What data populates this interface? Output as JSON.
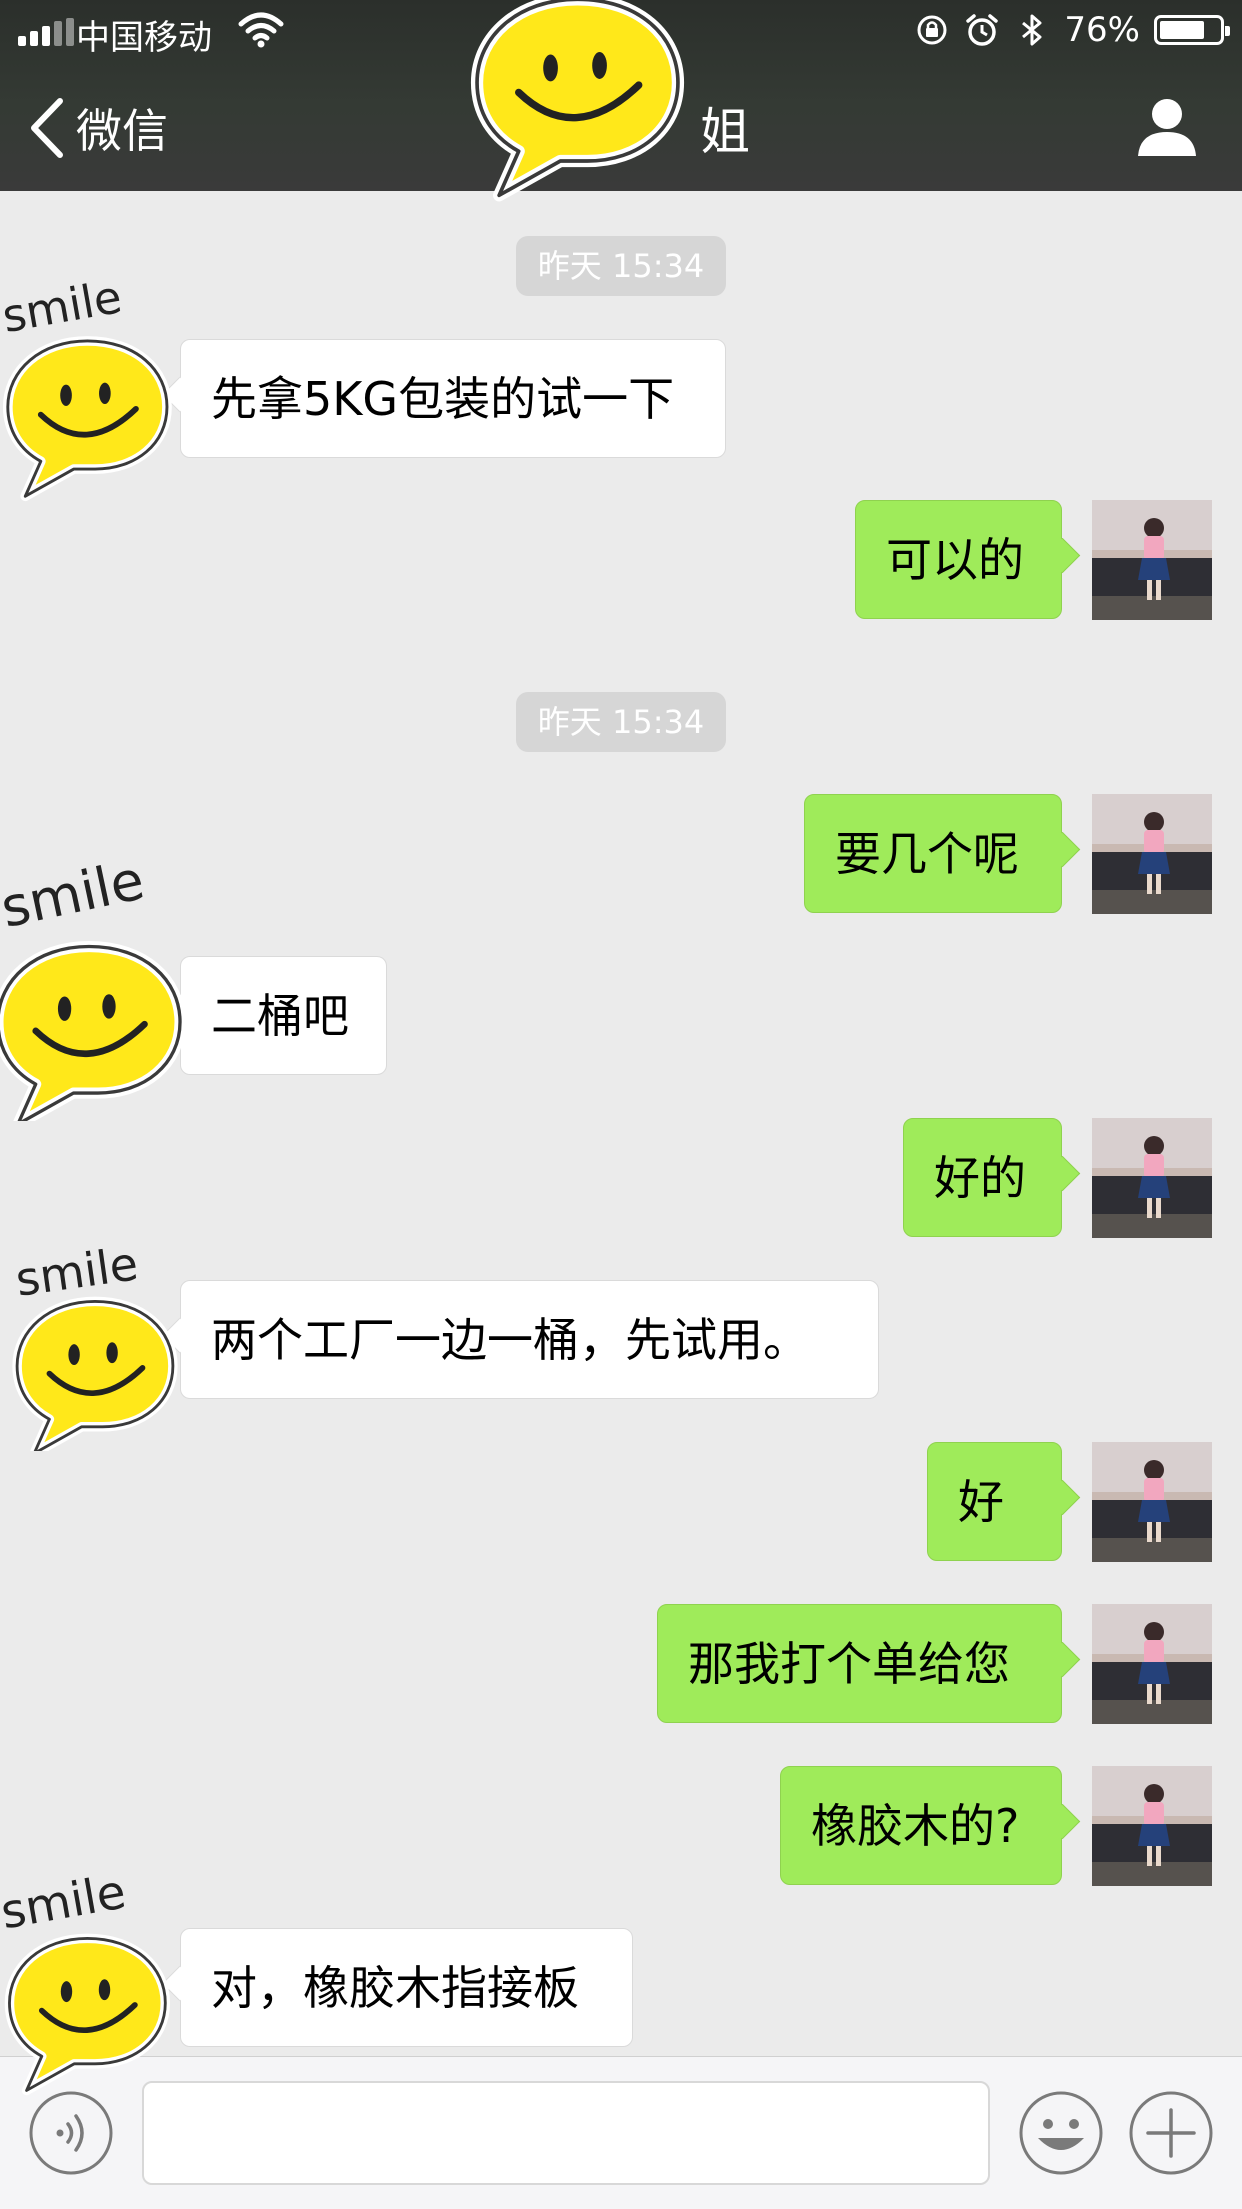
{
  "status_bar": {
    "carrier": "中国移动",
    "battery": "76%",
    "battery_level": 0.76
  },
  "nav": {
    "back_label": "微信",
    "title": "姐"
  },
  "messages": [
    {
      "type": "time",
      "text": "昨天 15:34"
    },
    {
      "side": "in",
      "text": "先拿5KG包装的试一下"
    },
    {
      "side": "out",
      "text": "可以的"
    },
    {
      "type": "time",
      "text": "昨天 15:34"
    },
    {
      "side": "out",
      "text": "要几个呢"
    },
    {
      "side": "in",
      "text": "二桶吧"
    },
    {
      "side": "out",
      "text": "好的"
    },
    {
      "side": "in",
      "text": "两个工厂一边一桶，先试用。"
    },
    {
      "side": "out",
      "text": "好"
    },
    {
      "side": "out",
      "text": "那我打个单给您"
    },
    {
      "side": "out",
      "text": "橡胶木的?"
    },
    {
      "side": "in",
      "text": "对，橡胶木指接板"
    }
  ],
  "sticker_text": "smile",
  "colors": {
    "header": "#2b2f2b",
    "chat_bg": "#ebebeb",
    "out_bubble": "#9feb5a",
    "in_bubble": "#ffffff"
  }
}
